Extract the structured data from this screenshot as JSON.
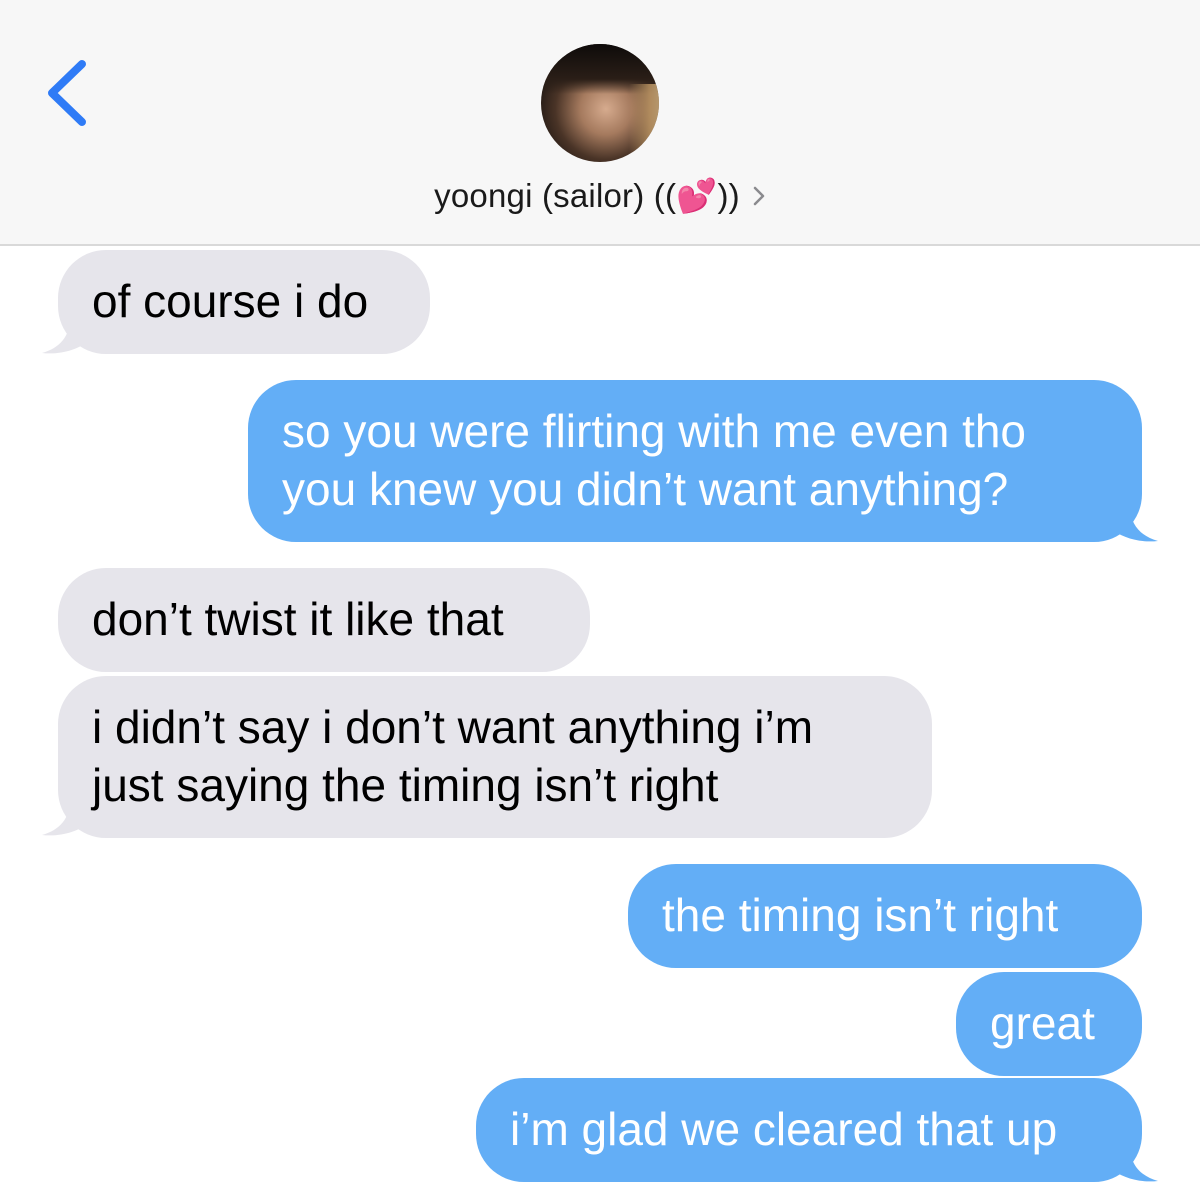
{
  "header": {
    "contact_name": "yoongi (sailor) ((💕))",
    "back_icon": "chevron-left-icon",
    "detail_icon": "chevron-right-icon",
    "accent_color": "#2f7bf6"
  },
  "messages": [
    {
      "direction": "received",
      "lines": [
        "of course i do"
      ]
    },
    {
      "direction": "sent",
      "lines": [
        "so you were flirting with me even tho",
        "you knew you didn’t want anything?"
      ]
    },
    {
      "direction": "received",
      "lines": [
        "don’t twist it like that"
      ]
    },
    {
      "direction": "received",
      "lines": [
        "i didn’t say i don’t want anything i’m",
        "just saying the timing isn’t right"
      ]
    },
    {
      "direction": "sent",
      "lines": [
        "the timing isn’t right"
      ]
    },
    {
      "direction": "sent",
      "lines": [
        "great"
      ]
    },
    {
      "direction": "sent",
      "lines": [
        "i’m glad we cleared that up"
      ]
    }
  ],
  "colors": {
    "sent_bubble": "#63aef6",
    "received_bubble": "#e6e5eb"
  }
}
